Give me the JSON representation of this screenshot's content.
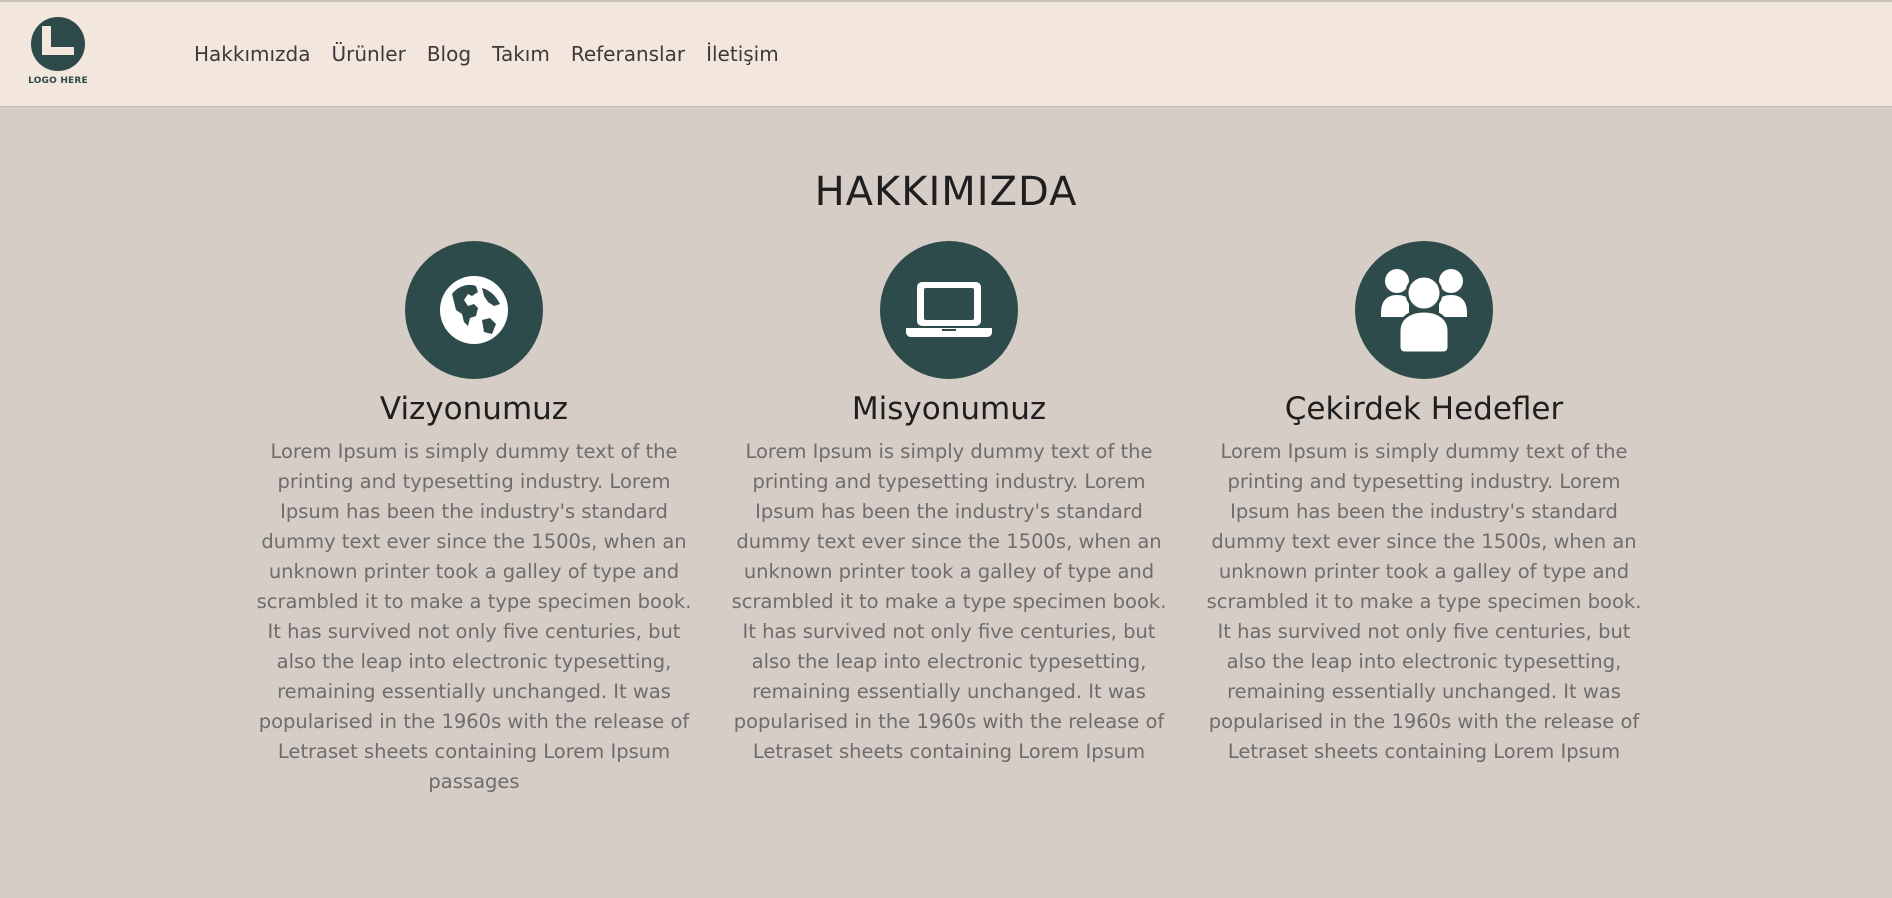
{
  "logo": {
    "text": "LOGO HERE"
  },
  "nav": {
    "items": [
      "Hakkımızda",
      "Ürünler",
      "Blog",
      "Takım",
      "Referanslar",
      "İletişim"
    ]
  },
  "colors": {
    "header_bg": "#f3e6dd",
    "page_bg": "#d6cdc6",
    "accent": "#2d4b4b"
  },
  "section": {
    "title": "HAKKIMIZDA",
    "cards": [
      {
        "icon": "globe-icon",
        "title": "Vizyonumuz",
        "text": "Lorem Ipsum is simply dummy text of the printing and typesetting industry. Lorem Ipsum has been the industry's standard dummy text ever since the 1500s, when an unknown printer took a galley of type and scrambled it to make a type specimen book. It has survived not only five centuries, but also the leap into electronic typesetting, remaining essentially unchanged. It was popularised in the 1960s with the release of Letraset sheets containing Lorem Ipsum passages"
      },
      {
        "icon": "laptop-icon",
        "title": "Misyonumuz",
        "text": "Lorem Ipsum is simply dummy text of the printing and typesetting industry. Lorem Ipsum has been the industry's standard dummy text ever since the 1500s, when an unknown printer took a galley of type and scrambled it to make a type specimen book. It has survived not only five centuries, but also the leap into electronic typesetting, remaining essentially unchanged. It was popularised in the 1960s with the release of Letraset sheets containing Lorem Ipsum"
      },
      {
        "icon": "users-icon",
        "title": "Çekirdek Hedefler",
        "text": "Lorem Ipsum is simply dummy text of the printing and typesetting industry. Lorem Ipsum has been the industry's standard dummy text ever since the 1500s, when an unknown printer took a galley of type and scrambled it to make a type specimen book. It has survived not only five centuries, but also the leap into electronic typesetting, remaining essentially unchanged. It was popularised in the 1960s with the release of Letraset sheets containing Lorem Ipsum"
      }
    ]
  }
}
